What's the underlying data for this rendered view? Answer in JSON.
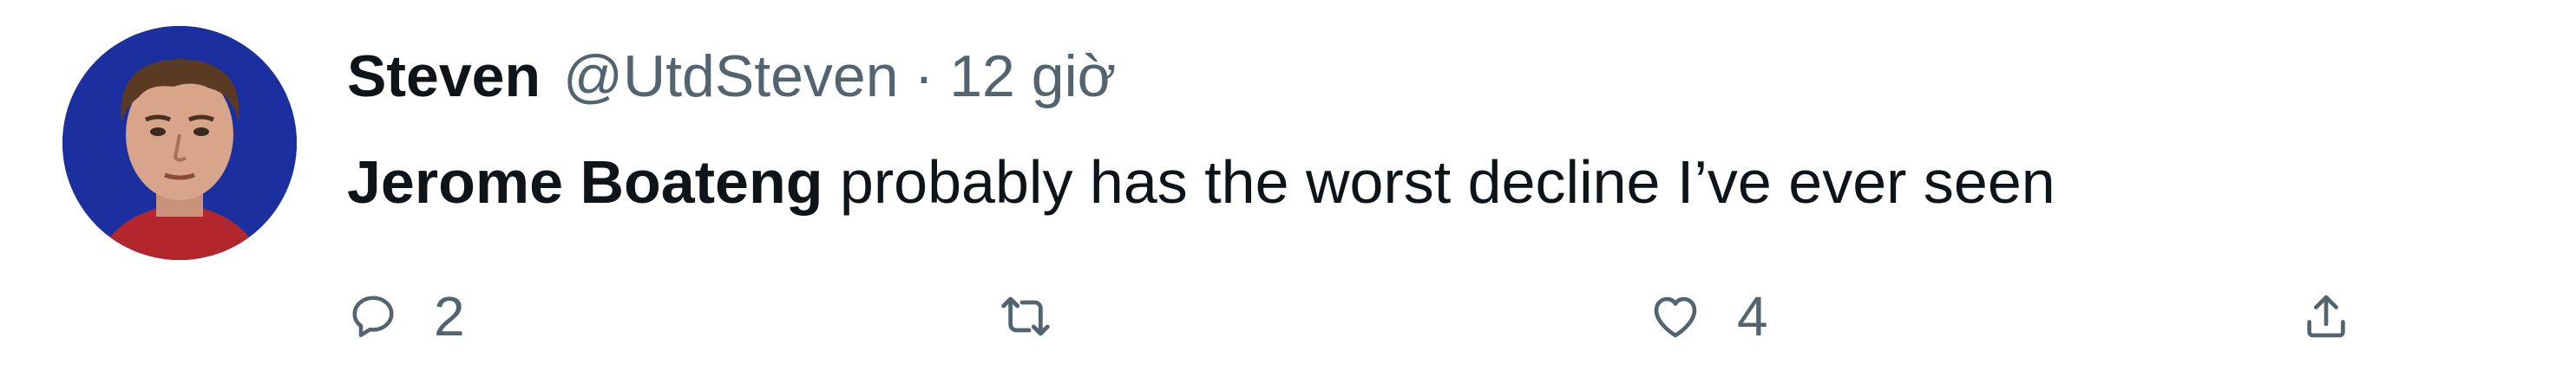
{
  "tweet": {
    "author": {
      "name": "Steven",
      "handle": "@UtdSteven"
    },
    "separator": "·",
    "time": "12 giờ",
    "text": {
      "mention": "Jerome Boateng",
      "rest": " probably has the worst decline I’ve ever seen"
    },
    "actions": {
      "reply": {
        "icon": "reply-icon",
        "count": "2"
      },
      "retweet": {
        "icon": "retweet-icon"
      },
      "like": {
        "icon": "heart-icon",
        "count": "4"
      },
      "share": {
        "icon": "share-icon"
      }
    }
  },
  "colors": {
    "text_primary": "#0f1419",
    "text_secondary": "#536471",
    "avatar_background": "#1c2f9e"
  }
}
